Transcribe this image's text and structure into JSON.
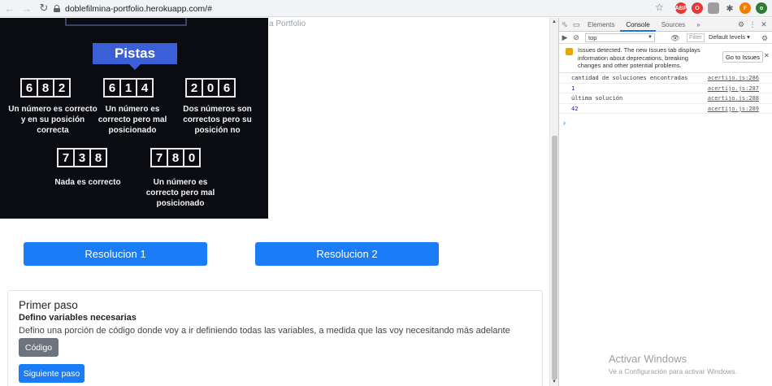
{
  "browser": {
    "url": "doblefilmina-portfolio.herokuapp.com/#",
    "extensions": [
      {
        "name": "adblock-icon",
        "color": "#e53935",
        "label": "ABP"
      },
      {
        "name": "opera-icon",
        "color": "#e53935",
        "label": "O"
      },
      {
        "name": "shield-icon",
        "color": "#9e9e9e",
        "label": ""
      },
      {
        "name": "puzzle-icon",
        "color": "#5f6368",
        "label": ""
      },
      {
        "name": "profile-avatar",
        "color": "#f57c00",
        "label": "F"
      },
      {
        "name": "extension-green-icon",
        "color": "#2e7d32",
        "label": "o"
      }
    ]
  },
  "page": {
    "partial_link": "a Portfolio",
    "puzzle": {
      "banner": "Pistas",
      "codes": [
        {
          "digits": [
            "6",
            "8",
            "2"
          ],
          "hint": "Un número es correcto y en su posición correcta"
        },
        {
          "digits": [
            "6",
            "1",
            "4"
          ],
          "hint": "Un número es correcto pero mal posicionado"
        },
        {
          "digits": [
            "2",
            "0",
            "6"
          ],
          "hint": "Dos números son correctos pero su posición no"
        },
        {
          "digits": [
            "7",
            "3",
            "8"
          ],
          "hint": "Nada es correcto"
        },
        {
          "digits": [
            "7",
            "8",
            "0"
          ],
          "hint": "Un número es correcto pero mal posicionado"
        }
      ]
    },
    "buttons": {
      "resolucion1": "Resolucion 1",
      "resolucion2": "Resolucion 2"
    },
    "card": {
      "title": "Primer paso",
      "subtitle": "Defino variables necesarias",
      "text": "Defino una porción de código donde voy a ir definiendo todas las variables, a medida que las voy necesitando más adelante",
      "code_button": "Código",
      "next_button": "Siguiente paso"
    }
  },
  "devtools": {
    "tabs": [
      "Elements",
      "Console",
      "Sources"
    ],
    "active_tab": "Console",
    "more_tabs": "»",
    "context": "top",
    "filter_placeholder": "Filter",
    "levels": "Default levels ▾",
    "issues_text": "Issues detected. The new Issues tab displays information about deprecations, breaking changes and other potential problems.",
    "goto_issues": "Go to Issues",
    "logs": [
      {
        "message": "cantidad de soluciones encontradas",
        "source": "acertijo.js:286",
        "numeric": false
      },
      {
        "message": "1",
        "source": "acertijo.js:287",
        "numeric": true
      },
      {
        "message": "última solución",
        "source": "acertijo.js:288",
        "numeric": false
      },
      {
        "message": "42",
        "source": "acertijo.js:289",
        "numeric": true
      }
    ],
    "prompt": "›"
  },
  "watermark": {
    "title": "Activar Windows",
    "subtitle": "Ve a Configuración para activar Windows."
  }
}
